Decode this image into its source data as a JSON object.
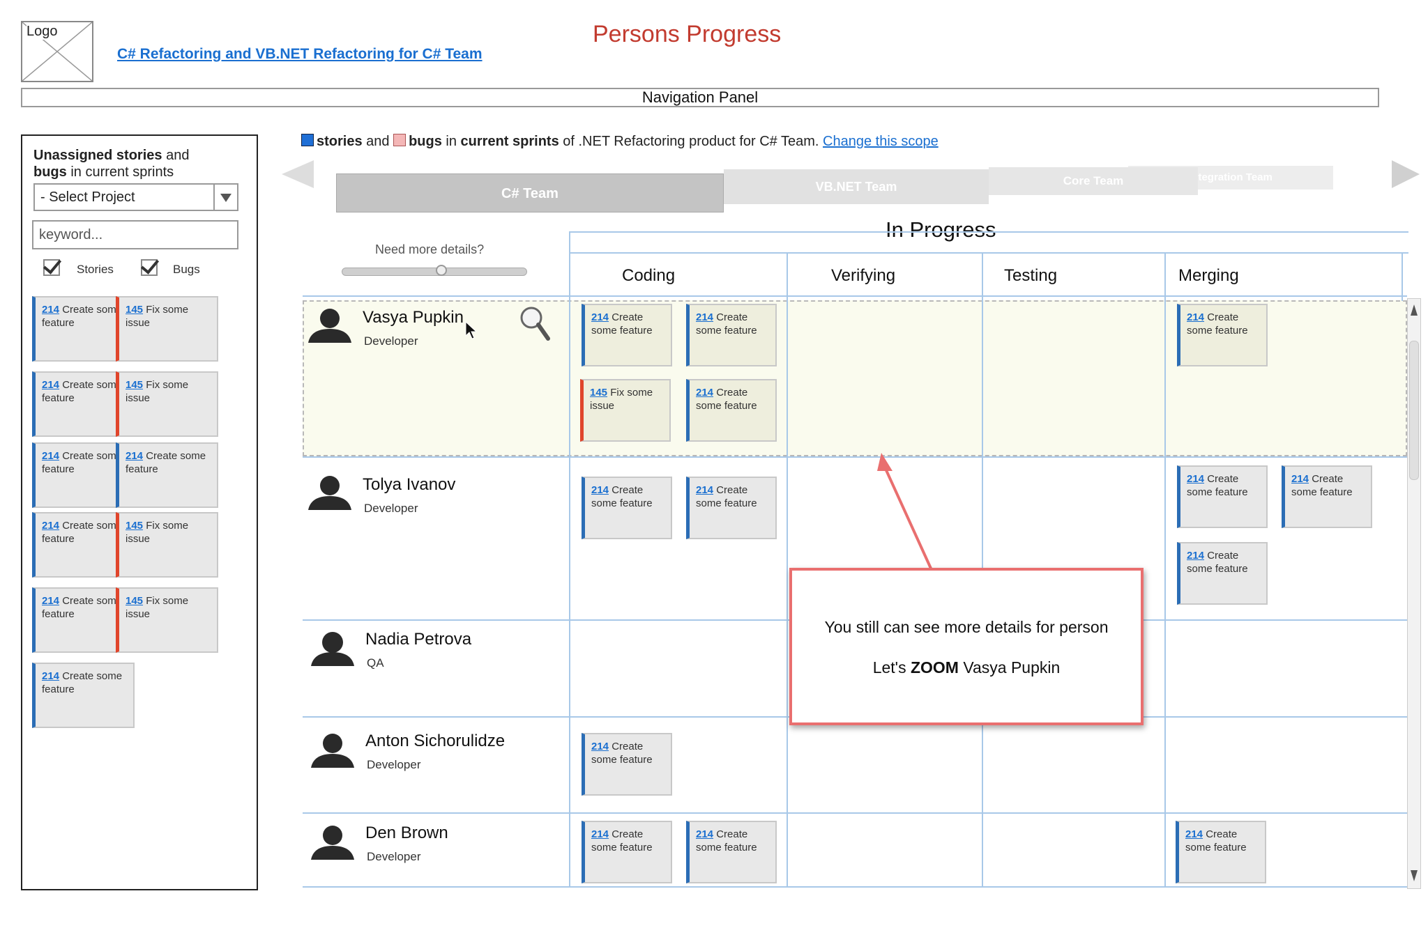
{
  "header": {
    "logo_label": "Logo",
    "team_link": "C# Refactoring and VB.NET Refactoring for C# Team",
    "page_title": "Persons Progress",
    "navigation_panel": "Navigation Panel"
  },
  "sidebar": {
    "title_bold1": "Unassigned stories",
    "title_mid": " and",
    "title_bold2": "bugs",
    "title_end": " in current sprints",
    "select_value": "- Select Project",
    "keyword_placeholder": "keyword...",
    "stories_label": "Stories",
    "bugs_label": "Bugs",
    "cards": [
      {
        "num": "214",
        "text": " Create some feature",
        "kind": "story"
      },
      {
        "num": "145",
        "text": " Fix some issue",
        "kind": "bug"
      },
      {
        "num": "214",
        "text": " Create some feature",
        "kind": "story"
      },
      {
        "num": "145",
        "text": " Fix some issue",
        "kind": "bug"
      },
      {
        "num": "214",
        "text": " Create some feature",
        "kind": "story"
      },
      {
        "num": "214",
        "text": " Create some feature",
        "kind": "story"
      },
      {
        "num": "214",
        "text": " Create some feature",
        "kind": "story"
      },
      {
        "num": "145",
        "text": " Fix some issue",
        "kind": "bug"
      },
      {
        "num": "214",
        "text": " Create some feature",
        "kind": "story"
      },
      {
        "num": "145",
        "text": " Fix some issue",
        "kind": "bug"
      },
      {
        "num": "214",
        "text": " Create some feature",
        "kind": "story"
      }
    ]
  },
  "scope": {
    "stories": "stories",
    "and": " and ",
    "bugs": "bugs",
    "in": " in ",
    "current_sprints": "current sprints",
    "rest": " of .NET Refactoring product for C# Team. ",
    "change_link": "Change this scope",
    "story_color": "#1f6fd6",
    "bug_color": "#f4b7b7"
  },
  "tabs": [
    "C# Team",
    "VB.NET Team",
    "Core Team",
    "Integration Team"
  ],
  "board": {
    "in_progress": "In Progress",
    "need_more": "Need more details?",
    "columns": [
      "Coding",
      "Verifying",
      "Testing",
      "Merging"
    ]
  },
  "persons": [
    {
      "name": "Vasya Pupkin",
      "role": "Developer"
    },
    {
      "name": "Tolya Ivanov",
      "role": "Developer"
    },
    {
      "name": "Nadia Petrova",
      "role": "QA"
    },
    {
      "name": "Anton Sichorulidze",
      "role": "Developer"
    },
    {
      "name": "Den Brown",
      "role": "Developer"
    }
  ],
  "board_cards": {
    "story_num": "214",
    "story_text": " Create some feature",
    "bug_num": "145",
    "bug_text": " Fix some issue"
  },
  "callout": {
    "line1": "You still can see more details for person",
    "line2_pre": "Let's ",
    "line2_bold": "ZOOM",
    "line2_post": " Vasya Pupkin"
  }
}
